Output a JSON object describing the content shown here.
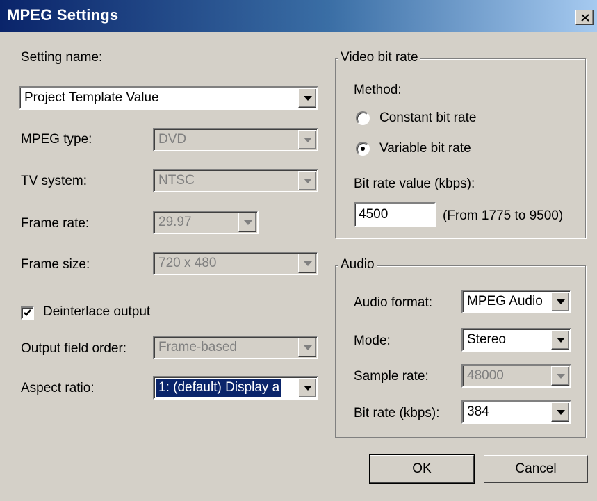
{
  "window": {
    "title": "MPEG Settings"
  },
  "left": {
    "setting_name_label": "Setting name:",
    "setting_name_value": "Project Template Value",
    "mpeg_type_label": "MPEG type:",
    "mpeg_type_value": "DVD",
    "tv_system_label": "TV system:",
    "tv_system_value": "NTSC",
    "frame_rate_label": "Frame rate:",
    "frame_rate_value": "29.97",
    "frame_size_label": "Frame size:",
    "frame_size_value": "720 x 480",
    "deinterlace_label": "Deinterlace output",
    "deinterlace_checked": true,
    "output_field_order_label": "Output field order:",
    "output_field_order_value": "Frame-based",
    "aspect_ratio_label": "Aspect ratio:",
    "aspect_ratio_value": "1: (default) Display a"
  },
  "video": {
    "group_title": "Video bit rate",
    "method_label": "Method:",
    "constant_label": "Constant bit rate",
    "variable_label": "Variable bit rate",
    "selected_method": "variable",
    "bitrate_label": "Bit rate value (kbps):",
    "bitrate_value": "4500",
    "bitrate_range": "(From 1775 to 9500)"
  },
  "audio": {
    "group_title": "Audio",
    "format_label": "Audio format:",
    "format_value": "MPEG Audio",
    "mode_label": "Mode:",
    "mode_value": "Stereo",
    "sample_rate_label": "Sample rate:",
    "sample_rate_value": "48000",
    "bitrate_label": "Bit rate (kbps):",
    "bitrate_value": "384"
  },
  "buttons": {
    "ok": "OK",
    "cancel": "Cancel"
  },
  "colors": {
    "face": "#d4d0c8",
    "title_start": "#0a246a",
    "title_end": "#a6caf0",
    "disabled_text": "#808080",
    "selection": "#0a246a"
  },
  "icons": {
    "close": "close-icon",
    "dropdown": "chevron-down-icon",
    "check": "check-icon"
  }
}
